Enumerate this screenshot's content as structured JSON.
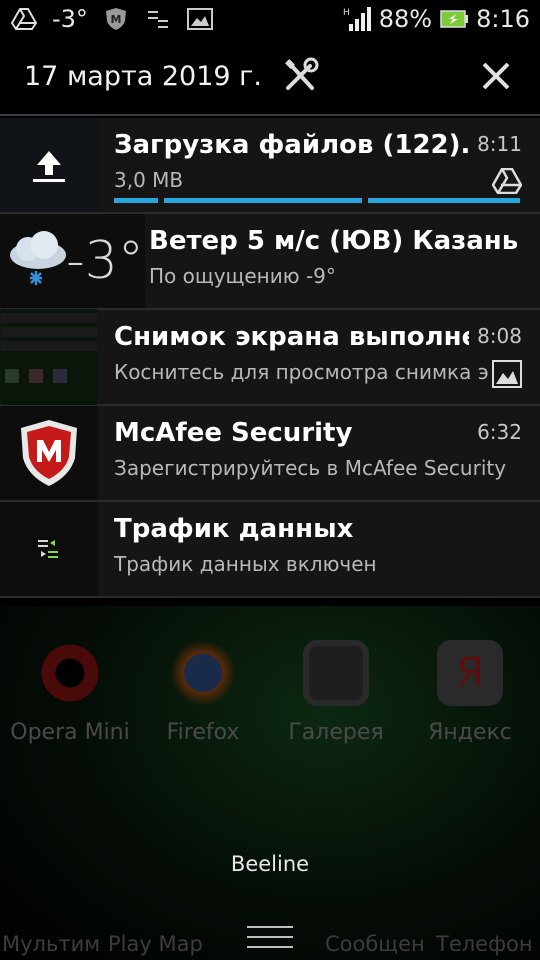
{
  "status_bar": {
    "temperature": "-3°",
    "battery_percent": "88%",
    "time": "8:16",
    "icons": [
      "drive-upload-icon",
      "mcafee-icon",
      "data-traffic-icon",
      "gallery-icon",
      "signal-icon",
      "battery-icon"
    ]
  },
  "header": {
    "date": "17 марта 2019 г."
  },
  "notifications": [
    {
      "title": "Загрузка файлов (122)...",
      "subtitle": "3,0 MB",
      "time": "8:11",
      "icon": "upload-icon",
      "small_icon": "drive-icon",
      "progress_segments": 3
    },
    {
      "temperature": "-3°",
      "title": "Ветер 5 м/с (ЮВ)  Казань",
      "subtitle": "По ощущению -9°",
      "icon": "snow-cloud-icon"
    },
    {
      "title": "Снимок экрана выполнен",
      "subtitle": "Коснитесь для просмотра снимка экрана",
      "time": "8:08",
      "icon": "screenshot-thumbnail",
      "small_icon": "gallery-icon"
    },
    {
      "title": "McAfee Security",
      "subtitle": "Зарегистрируйтесь в McAfee Security",
      "time": "6:32",
      "icon": "mcafee-shield-icon"
    },
    {
      "title": "Трафик данных",
      "subtitle": "Трафик данных включен",
      "icon": "data-traffic-icon"
    }
  ],
  "home_apps": [
    {
      "label": "Opera Mini",
      "color": "#8a1010"
    },
    {
      "label": "Firefox",
      "color": "#8a4a10"
    },
    {
      "label": "Галерея",
      "color": "#3a3a3a"
    },
    {
      "label": "Яндекс",
      "color": "#5a1a1a"
    }
  ],
  "carrier": "Beeline",
  "dock_apps": [
    "Мультим",
    "Play Мар",
    "Сообщен",
    "Телефон"
  ]
}
